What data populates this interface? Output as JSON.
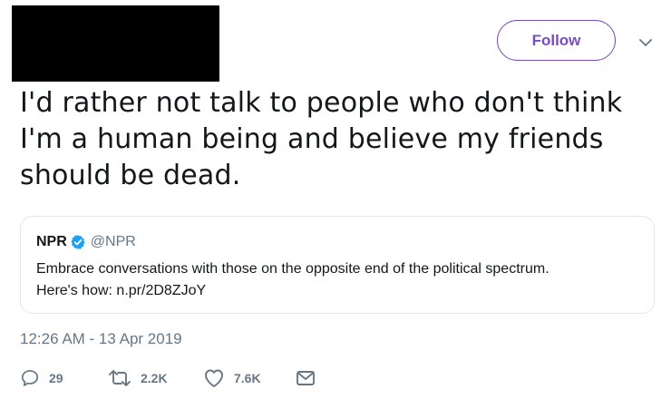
{
  "header": {
    "follow_label": "Follow"
  },
  "tweet": {
    "text": "I'd rather not talk to people who don't think\nI'm a human being and believe my friends\nshould be dead."
  },
  "quote": {
    "name": "NPR",
    "handle": "@NPR",
    "text_line1": "Embrace conversations with those on the opposite end of the political spectrum.",
    "text_line2": "Here's how: n.pr/2D8ZJoY"
  },
  "timestamp": "12:26 AM - 13 Apr 2019",
  "actions": {
    "replies": "29",
    "retweets": "2.2K",
    "likes": "7.6K"
  },
  "colors": {
    "accent": "#794bc4",
    "muted": "#657786",
    "verified": "#1da1f2",
    "border": "#e1e8ed"
  },
  "icons": [
    "chevron-down-icon",
    "verified-icon",
    "reply-icon",
    "retweet-icon",
    "like-icon",
    "direct-message-icon"
  ]
}
